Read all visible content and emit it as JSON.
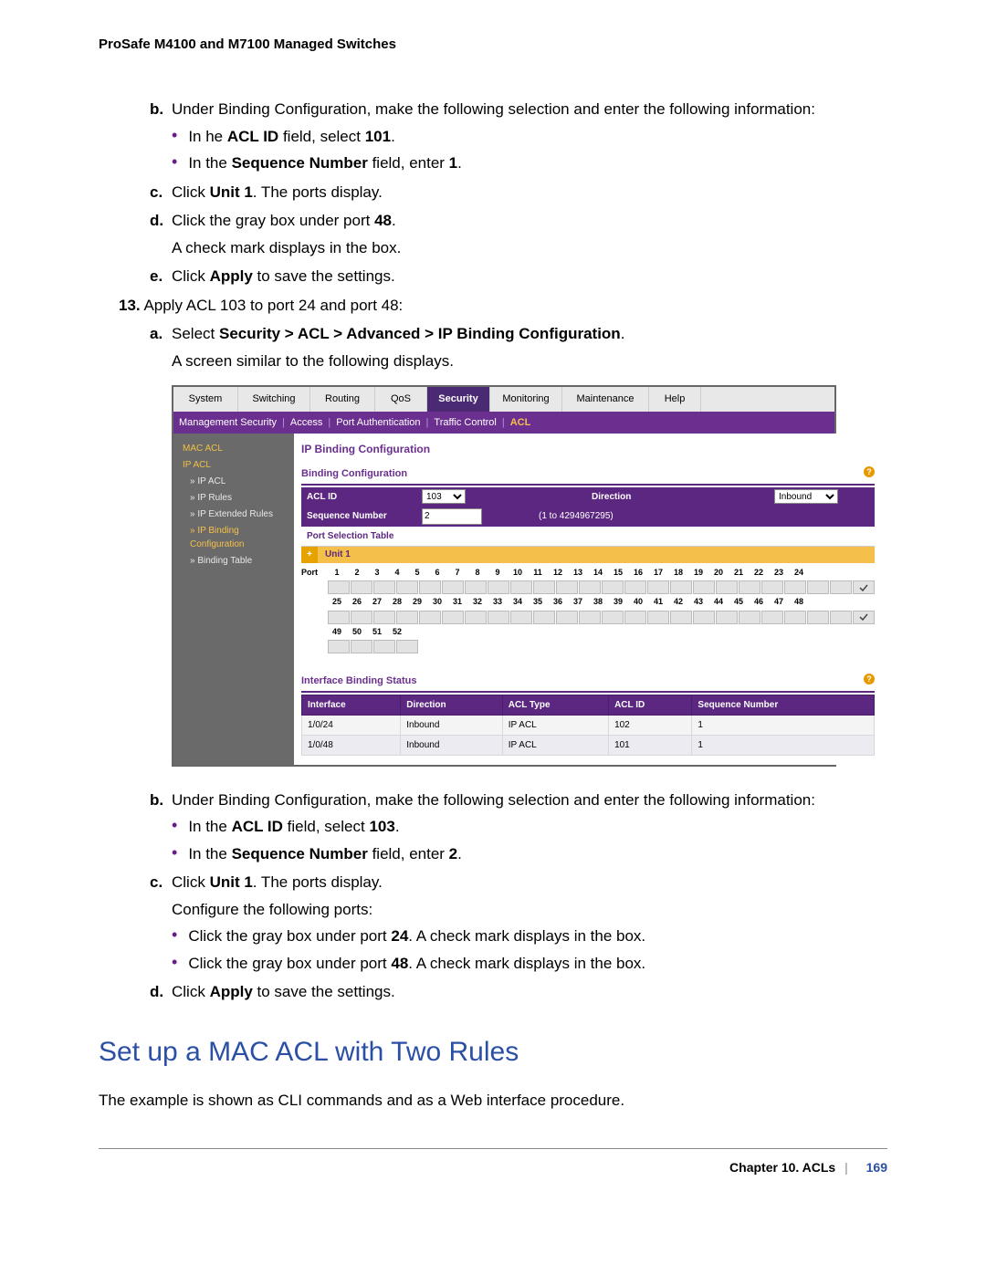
{
  "header": "ProSafe M4100 and M7100 Managed Switches",
  "steps": {
    "b1_intro": "Under Binding Configuration, make the following selection and enter the following information:",
    "b1_bullets": [
      {
        "pre": "In he ",
        "b": "ACL ID",
        "post": " field, select ",
        "v": "101",
        "tail": "."
      },
      {
        "pre": "In the ",
        "b": "Sequence Number",
        "post": " field, enter ",
        "v": "1",
        "tail": "."
      }
    ],
    "c1_pre": "Click ",
    "c1_b": "Unit 1",
    "c1_post": ". The ports display.",
    "d1_pre": "Click the gray box under port ",
    "d1_b": "48",
    "d1_post": ".",
    "d1_line2": "A check mark displays in the box.",
    "e1_pre": "Click ",
    "e1_b": "Apply",
    "e1_post": " to save the settings.",
    "s13_num": "13.",
    "s13_text": "Apply ACL 103 to port 24 and port 48:",
    "a_pre": "Select ",
    "a_b": "Security > ACL > Advanced > IP Binding Configuration",
    "a_post": ".",
    "a_line2": "A screen similar to the following displays.",
    "b2_intro": "Under Binding Configuration, make the following selection and enter the following information:",
    "b2_bullets": [
      {
        "pre": "In the ",
        "b": "ACL ID",
        "post": " field, select ",
        "v": "103",
        "tail": "."
      },
      {
        "pre": "In the ",
        "b": "Sequence Number",
        "post": " field, enter ",
        "v": "2",
        "tail": "."
      }
    ],
    "c2_pre": "Click ",
    "c2_b": "Unit 1",
    "c2_post": ". The ports display.",
    "c2_line2": "Configure the following ports:",
    "c2_bullets": [
      {
        "pre": "Click the gray box under port ",
        "b": "24",
        "post": ". A check mark displays in the box."
      },
      {
        "pre": "Click the gray box under port ",
        "b": "48",
        "post": ". A check mark displays in the box."
      }
    ],
    "d2_pre": "Click ",
    "d2_b": "Apply",
    "d2_post": " to save the settings."
  },
  "section_title": "Set up a MAC ACL with Two Rules",
  "section_intro": "The example is shown as CLI commands and as a Web interface procedure.",
  "footer": {
    "chapter": "Chapter 10.  ACLs",
    "page": "169"
  },
  "screenshot": {
    "tabs": [
      "System",
      "Switching",
      "Routing",
      "QoS",
      "Security",
      "Monitoring",
      "Maintenance",
      "Help"
    ],
    "tab_widths": [
      70,
      78,
      70,
      56,
      68,
      78,
      94,
      56
    ],
    "active_tab": 4,
    "subnav": [
      "Management Security",
      "Access",
      "Port Authentication",
      "Traffic Control",
      "ACL"
    ],
    "subnav_active": 4,
    "sidebar": [
      {
        "t": "MAC ACL",
        "cls": "grp"
      },
      {
        "t": "IP ACL",
        "cls": "grp"
      },
      {
        "t": "» IP ACL",
        "cls": "sub"
      },
      {
        "t": "» IP Rules",
        "cls": "sub"
      },
      {
        "t": "» IP Extended Rules",
        "cls": "sub"
      },
      {
        "t": "» IP Binding Configuration",
        "cls": "cur"
      },
      {
        "t": "» Binding Table",
        "cls": "sub"
      }
    ],
    "panel_title": "IP Binding Configuration",
    "binding_section": "Binding Configuration",
    "acl_id_label": "ACL ID",
    "acl_id_value": "103",
    "direction_label": "Direction",
    "direction_value": "Inbound",
    "seq_label": "Sequence Number",
    "seq_value": "2",
    "seq_hint": "(1 to 4294967295)",
    "pst_label": "Port Selection Table",
    "unit_label": "Unit 1",
    "port_label": "Port",
    "checked_ports": [
      24,
      48
    ],
    "status_section": "Interface Binding Status",
    "status_headers": [
      "Interface",
      "Direction",
      "ACL Type",
      "ACL ID",
      "Sequence Number"
    ],
    "status_rows": [
      [
        "1/0/24",
        "Inbound",
        "IP ACL",
        "102",
        "1"
      ],
      [
        "1/0/48",
        "Inbound",
        "IP ACL",
        "101",
        "1"
      ]
    ]
  }
}
